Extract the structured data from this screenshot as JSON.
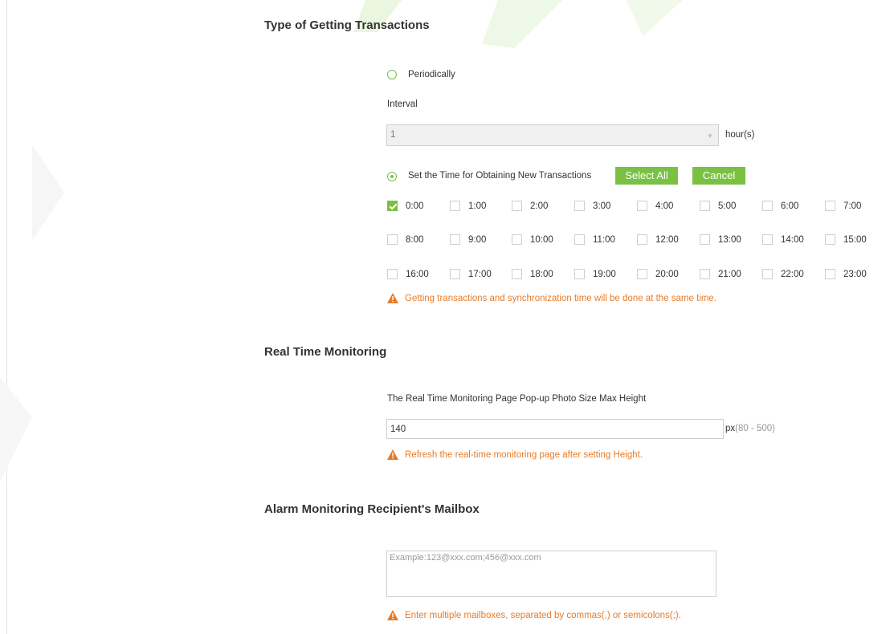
{
  "sections": {
    "transactions": {
      "title": "Type of Getting Transactions",
      "periodically_label": "Periodically",
      "interval_label": "Interval",
      "interval_value": "1",
      "interval_unit": "hour(s)",
      "set_time_label": "Set the Time for Obtaining New Transactions",
      "select_all_label": "Select All",
      "cancel_label": "Cancel",
      "hours": [
        "0:00",
        "1:00",
        "2:00",
        "3:00",
        "4:00",
        "5:00",
        "6:00",
        "7:00",
        "8:00",
        "9:00",
        "10:00",
        "11:00",
        "12:00",
        "13:00",
        "14:00",
        "15:00",
        "16:00",
        "17:00",
        "18:00",
        "19:00",
        "20:00",
        "21:00",
        "22:00",
        "23:00"
      ],
      "checked_hours": [
        "0:00"
      ],
      "warning": "Getting transactions and synchronization time will be done at the same time."
    },
    "realtime": {
      "title": "Real Time Monitoring",
      "photo_size_label": "The Real Time Monitoring Page Pop-up Photo Size   Max Height",
      "height_value": "140",
      "unit": "px",
      "range": "(80 - 500)",
      "warning": "Refresh the real-time monitoring page after setting Height."
    },
    "mailbox": {
      "title": "Alarm Monitoring Recipient's Mailbox",
      "placeholder": "Example:123@xxx.com;456@xxx.com",
      "warning": "Enter multiple mailboxes, separated by commas(,) or semicolons(;)."
    }
  },
  "colors": {
    "accent": "#7ac143",
    "warning": "#e87b27"
  },
  "icons": {
    "warning": "warning-triangle-icon",
    "caret": "chevron-down-icon"
  }
}
